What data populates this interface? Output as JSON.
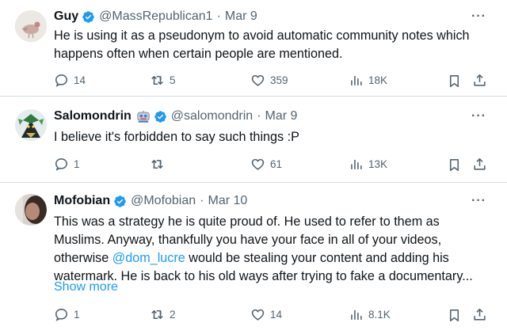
{
  "colors": {
    "accent": "#1d9bf0",
    "muted": "#536471",
    "text": "#0f1419"
  },
  "tweets": [
    {
      "name": "Guy",
      "handle": "@MassRepublican1",
      "separator": "·",
      "date": "Mar 9",
      "more": "···",
      "lines": [
        "He is using it as a pseudonym to avoid automatic community notes which",
        "happens often when certain people are mentioned."
      ],
      "replies": "14",
      "retweets": "5",
      "likes": "359",
      "views": "18K"
    },
    {
      "name": "Salomondrin",
      "handle": "@salomondrin",
      "separator": "·",
      "date": "Mar 9",
      "more": "···",
      "lines": [
        "I believe it's forbidden to say such things :P"
      ],
      "replies": "1",
      "retweets": "",
      "likes": "61",
      "views": "13K"
    },
    {
      "name": "Mofobian",
      "handle": "@Mofobian",
      "separator": "·",
      "date": "Mar 10",
      "more": "···",
      "lines": [
        "This was a strategy he is quite proud of. He used to refer to them as",
        "Muslims. Anyway, thankfully you have your face in all of your videos,",
        "otherwise",
        "@dom_lucre",
        "would be stealing your content and adding his",
        "watermark. He is back to his old ways after trying to fake a documentary..."
      ],
      "show_more": "Show more",
      "replies": "1",
      "retweets": "2",
      "likes": "14",
      "views": "8.1K"
    }
  ]
}
